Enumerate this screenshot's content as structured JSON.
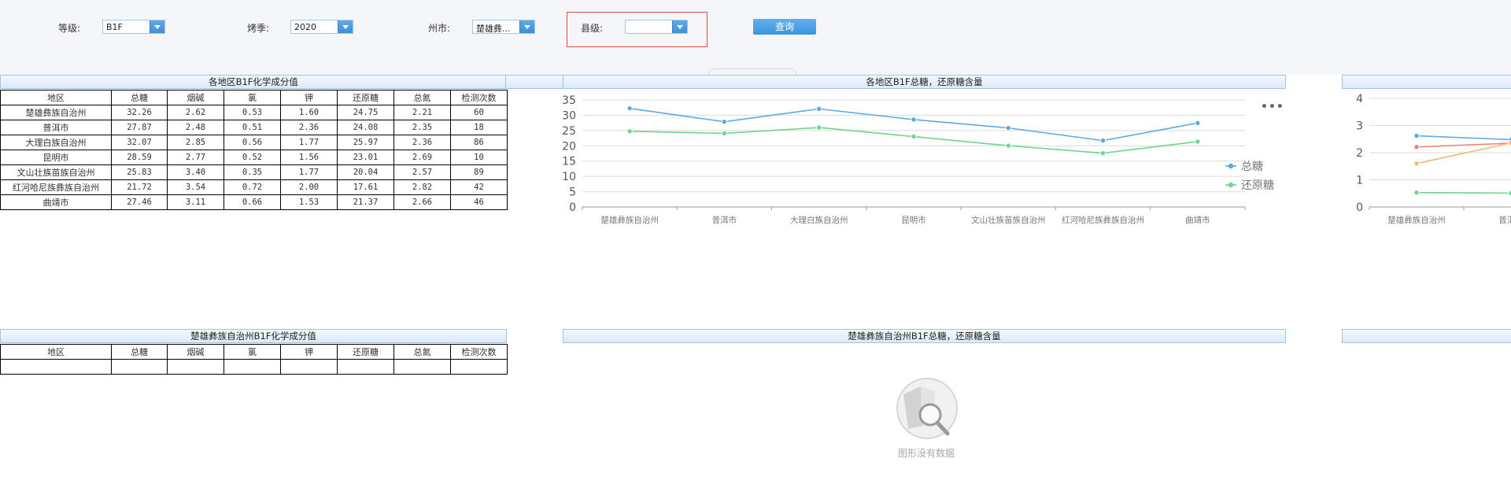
{
  "filters": {
    "grade": {
      "label": "等级:",
      "value": "B1F"
    },
    "season": {
      "label": "烤季:",
      "value": "2020"
    },
    "city": {
      "label": "州市:",
      "value": "楚雄彝..."
    },
    "county": {
      "label": "县级:",
      "value": ""
    },
    "query_label": "查询"
  },
  "table1": {
    "title": "各地区B1F化学成分值",
    "headers": [
      "地区",
      "总糖",
      "烟碱",
      "氯",
      "钾",
      "还原糖",
      "总氮",
      "检测次数"
    ],
    "rows": [
      [
        "楚雄彝族自治州",
        "32.26",
        "2.62",
        "0.53",
        "1.60",
        "24.75",
        "2.21",
        "60"
      ],
      [
        "普洱市",
        "27.87",
        "2.48",
        "0.51",
        "2.36",
        "24.08",
        "2.35",
        "18"
      ],
      [
        "大理白族自治州",
        "32.07",
        "2.85",
        "0.56",
        "1.77",
        "25.97",
        "2.36",
        "86"
      ],
      [
        "昆明市",
        "28.59",
        "2.77",
        "0.52",
        "1.56",
        "23.01",
        "2.69",
        "10"
      ],
      [
        "文山壮族苗族自治州",
        "25.83",
        "3.40",
        "0.35",
        "1.77",
        "20.04",
        "2.57",
        "89"
      ],
      [
        "红河哈尼族彝族自治州",
        "21.72",
        "3.54",
        "0.72",
        "2.00",
        "17.61",
        "2.82",
        "42"
      ],
      [
        "曲靖市",
        "27.46",
        "3.11",
        "0.66",
        "1.53",
        "21.37",
        "2.66",
        "46"
      ]
    ]
  },
  "table2": {
    "title": "楚雄彝族自治州B1F化学成分值",
    "headers": [
      "地区",
      "总糖",
      "烟碱",
      "氯",
      "钾",
      "还原糖",
      "总氮",
      "检测次数"
    ]
  },
  "chart1_title": "各地区B1F总糖，还原糖含量",
  "chart2_title": "楚雄彝族自治州B1F总糖，还原糖含量",
  "nodata_text": "图形没有数据",
  "chart_data": [
    {
      "type": "line",
      "title": "各地区B1F总糖，还原糖含量",
      "categories": [
        "楚雄彝族自治州",
        "普洱市",
        "大理白族自治州",
        "昆明市",
        "文山壮族苗族自治州",
        "红河哈尼族彝族自治州",
        "曲靖市"
      ],
      "series": [
        {
          "name": "总糖",
          "color": "#5aa9e6",
          "values": [
            32.26,
            27.87,
            32.07,
            28.59,
            25.83,
            21.72,
            27.46
          ]
        },
        {
          "name": "还原糖",
          "color": "#6fd391",
          "values": [
            24.75,
            24.08,
            25.97,
            23.01,
            20.04,
            17.61,
            21.37
          ]
        }
      ],
      "yticks": [
        0,
        5,
        10,
        15,
        20,
        25,
        30,
        35
      ],
      "ylim": [
        0,
        35
      ],
      "grid": true,
      "legend": "right"
    },
    {
      "type": "line",
      "title": "",
      "categories": [
        "楚雄彝族自治州",
        "普洱市"
      ],
      "series": [
        {
          "color": "#5aa9e6",
          "values": [
            2.62,
            2.48
          ]
        },
        {
          "color": "#f07d6e",
          "values": [
            2.21,
            2.35
          ]
        },
        {
          "color": "#f7b86b",
          "values": [
            1.6,
            2.36
          ]
        },
        {
          "color": "#6fd391",
          "values": [
            0.53,
            0.51
          ]
        }
      ],
      "yticks": [
        0,
        1,
        2,
        3,
        4
      ],
      "ylim": [
        0,
        4
      ],
      "grid": true
    }
  ]
}
